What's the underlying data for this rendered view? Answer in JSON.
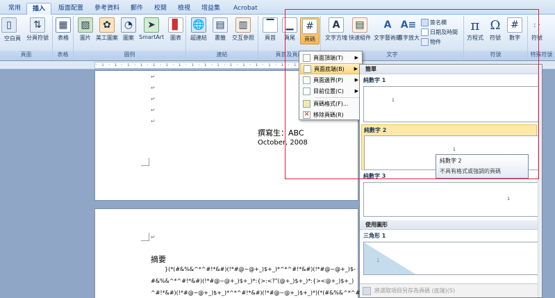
{
  "tabs": [
    "常用",
    "插入",
    "版面配置",
    "參考資料",
    "郵件",
    "校閱",
    "檢視",
    "增益集",
    "Acrobat"
  ],
  "active_tab": "插入",
  "ribbon": {
    "page_group": {
      "label": "頁面",
      "cover": "",
      "blank": "空白頁",
      "break": "分頁符號"
    },
    "table_group": {
      "label": "表格",
      "table": "表格"
    },
    "illustrations_group": {
      "label": "圖例",
      "picture": "圖片",
      "clipart": "美工圖案",
      "shapes": "圖案",
      "smartart": "SmartArt",
      "chart": "圖表"
    },
    "links_group": {
      "label": "連結",
      "hyperlink": "超連結",
      "bookmark": "書籤",
      "crossref": "交互參照"
    },
    "header_group": {
      "label": "頁首及頁尾",
      "header": "頁首",
      "footer": "頁尾",
      "pagenum": "頁碼"
    },
    "text_group": {
      "label": "文字",
      "textbox": "文字方塊",
      "quickparts": "快速組件",
      "wordart": "文字藝術師",
      "dropcap": "首字放大",
      "signature": "簽名欄",
      "datetime": "日期及時間",
      "object": "物件"
    },
    "symbols_group": {
      "label": "符號",
      "equation": "方程式",
      "symbol": "符號",
      "number": "數字"
    },
    "special_group": {
      "label": "特殊符號",
      "symbol": "符號"
    }
  },
  "document": {
    "author_line": "撰寫生：ABC",
    "date_line": "October, 2008",
    "abstract_title": "摘要",
    "garbled_lines": [
      "}(*(#&%&^*^#!*&#)(!*#@~@+_)$+_)*^*^#!*&#)(!*#@~@+_)$-",
      "#&%&^*^#!*&#)(!*#@~@+_)$+_)*:{>:<?\"(@+_)$+_)*:{><@+_)$+_)",
      "^#!*&#)(!*#@~@+_)$+_)*^*^#!*&#)(!*#@~@+_)$+_)*)(*(#&%&^*^#!*&#)(!*#@~"
    ]
  },
  "menu": {
    "items": [
      {
        "label": "頁面頂端(T)",
        "submenu": true
      },
      {
        "label": "頁面底端(B)",
        "submenu": true,
        "highlighted": true
      },
      {
        "label": "頁面邊界(P)",
        "submenu": true
      },
      {
        "label": "目前位置(C)",
        "submenu": true
      },
      {
        "label": "頁碼格式(F)...",
        "submenu": false
      },
      {
        "label": "移除頁碼(R)",
        "submenu": false
      }
    ]
  },
  "gallery": {
    "section_simple": "簡單",
    "items": [
      "純數字 1",
      "純數字 2",
      "純數字 3"
    ],
    "section_shapes": "使用圖形",
    "shape_item": "三角形 1",
    "footer": "將選取項目另存為頁碼 (底端)(S)"
  },
  "tooltip": {
    "title": "純數字 2",
    "description": "不具有格式或強調的頁碼"
  },
  "colors": {
    "accent": "#15428b",
    "highlight": "#ffd67a",
    "annotation_box": "#e0203a"
  }
}
